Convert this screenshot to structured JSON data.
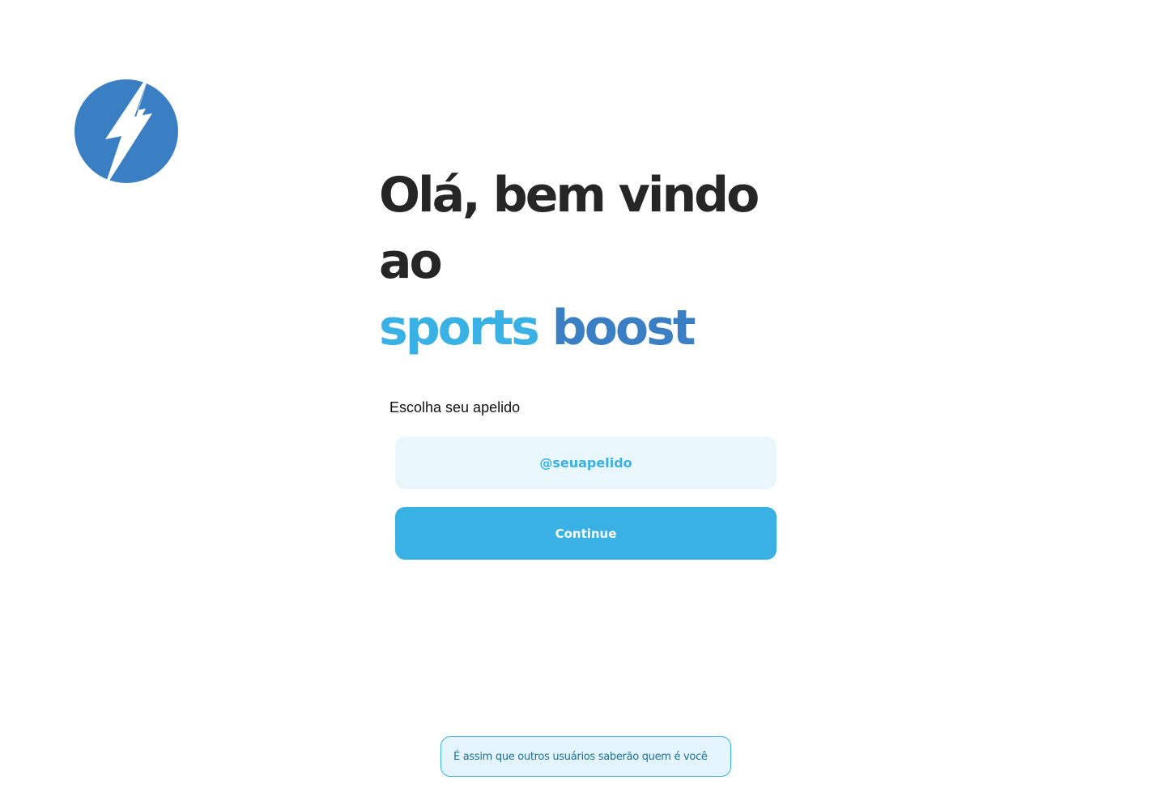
{
  "colors": {
    "brand_light": "#3ab1e4",
    "brand_dark": "#3a7fc4",
    "heading": "#262626",
    "input_bg": "#e9f6fc",
    "button_bg": "#39b1e4",
    "hint_bg": "#e3f4fc"
  },
  "logo": {
    "icon": "lightning-bolt-icon"
  },
  "heading": {
    "line1": "Olá, bem vindo ao",
    "brand_part1": "sports",
    "brand_part2": "boost"
  },
  "form": {
    "label": "Escolha seu apelido",
    "nickname_placeholder": "@seuapelido",
    "nickname_value": "",
    "continue_label": "Continue"
  },
  "hint": {
    "text": "É assim que outros usuários saberão quem é você"
  }
}
